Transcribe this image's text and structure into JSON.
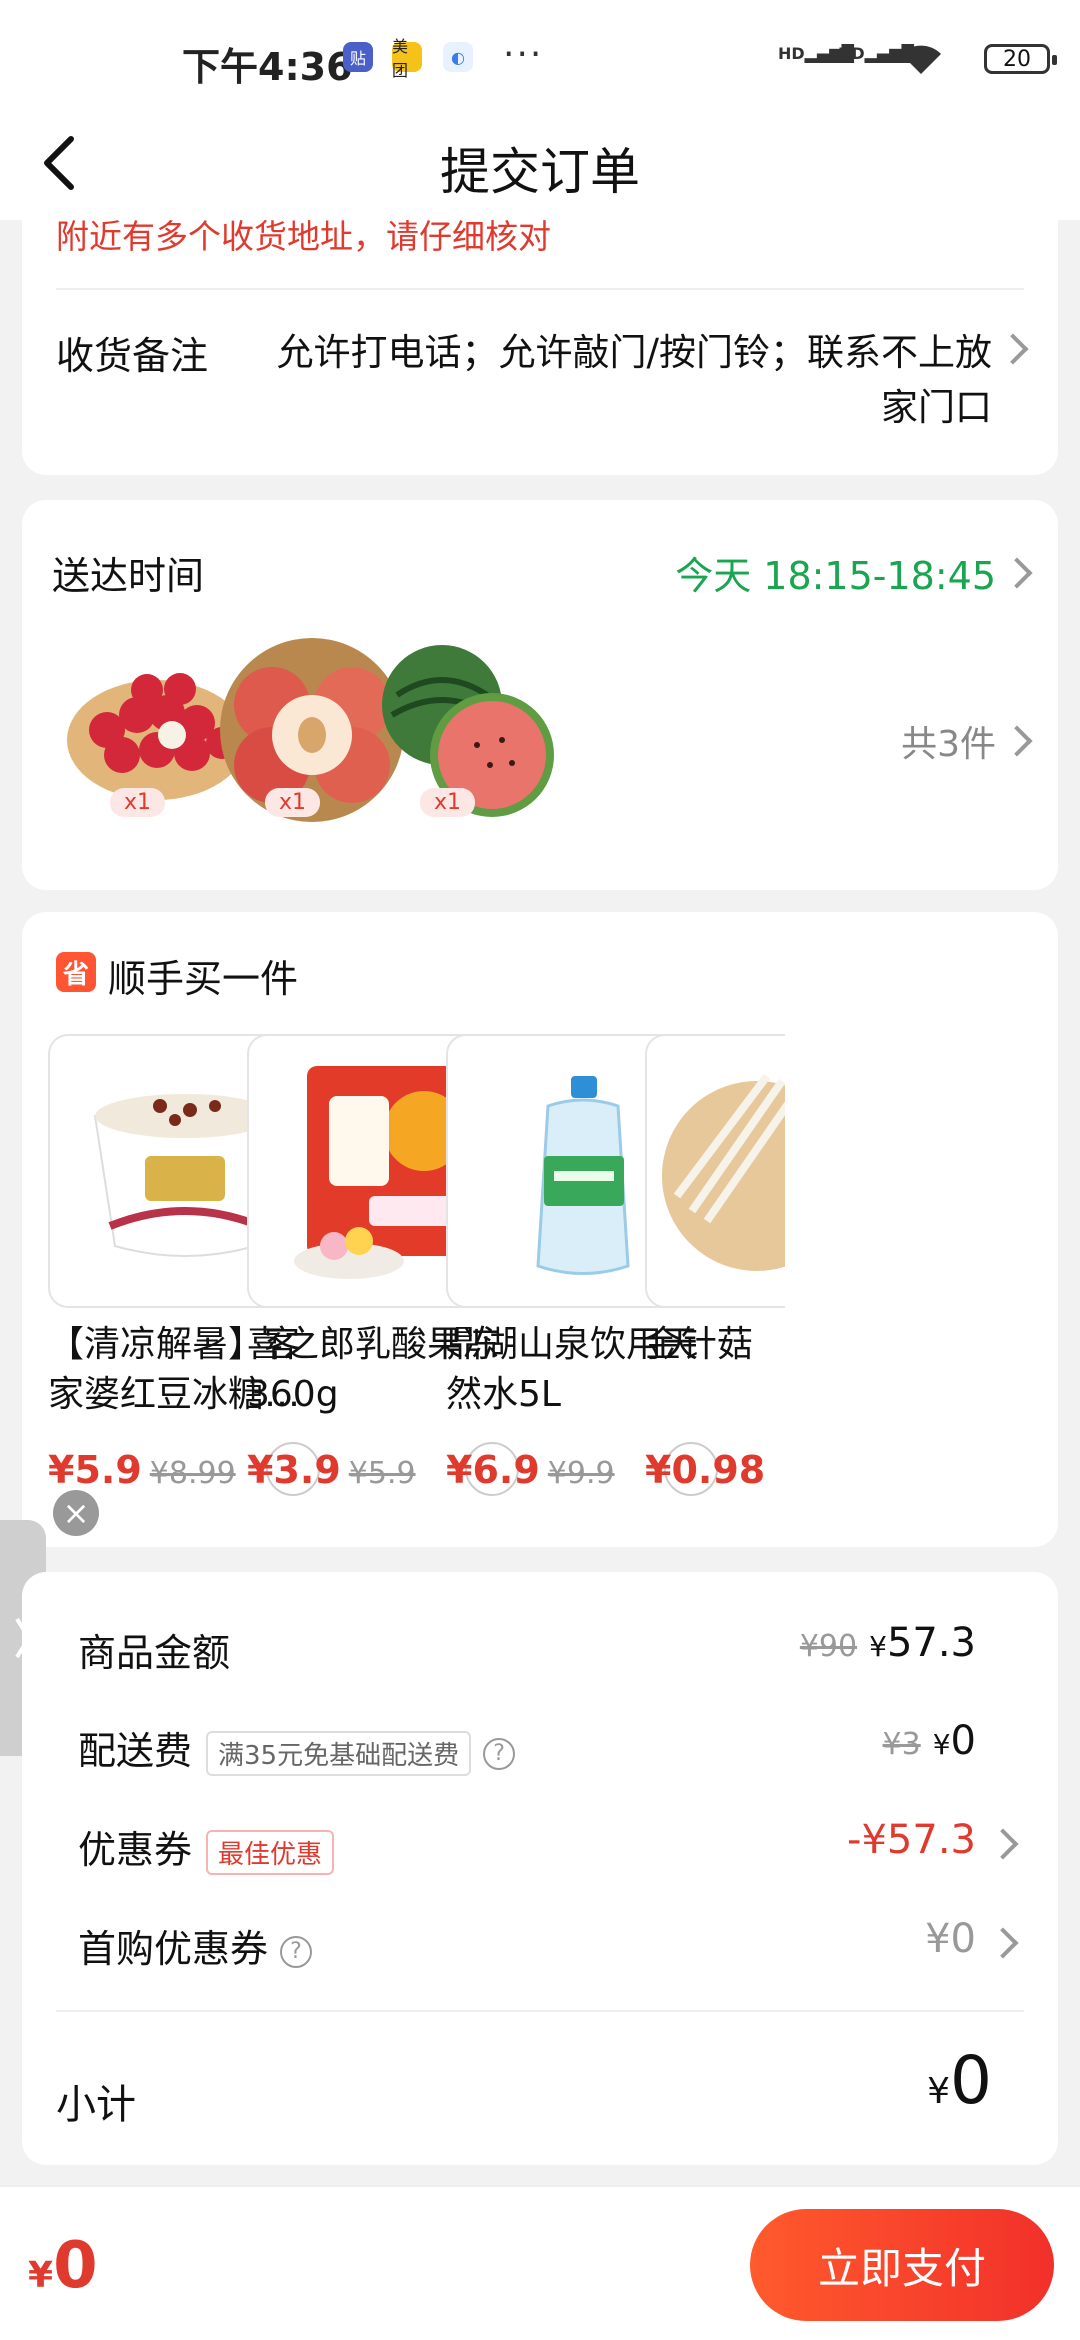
{
  "status_bar": {
    "time": "下午4:36",
    "battery": "20",
    "icons": [
      "tie-icon",
      "meituan-icon",
      "app-icon"
    ],
    "dots": "···",
    "signal": [
      "HD",
      "HD"
    ]
  },
  "nav": {
    "title": "提交订单"
  },
  "address": {
    "warning": "附近有多个收货地址，请仔细核对",
    "note_label": "收货备注",
    "note_value": "允许打电话；允许敲门/按门铃；联系不上放家门口"
  },
  "delivery": {
    "label": "送达时间",
    "time": "今天 18:15-18:45",
    "products": [
      {
        "name": "荔枝",
        "qty": "x1"
      },
      {
        "name": "桃子",
        "qty": "x1"
      },
      {
        "name": "西瓜",
        "qty": "x1"
      }
    ],
    "count": "共3件"
  },
  "addon": {
    "badge": "省",
    "title": "顺手买一件",
    "items": [
      {
        "name": "【清凉解暑】客家婆红豆冰糖…",
        "price": "¥5.9",
        "orig": "¥8.99"
      },
      {
        "name": "喜之郎乳酸果冻360g",
        "price": "¥3.9",
        "orig": "¥5.9"
      },
      {
        "name": "鼎湖山泉饮用天然水5L",
        "price": "¥6.9",
        "orig": "¥9.9"
      },
      {
        "name": "金针菇",
        "price": "¥0.98",
        "orig": ""
      }
    ]
  },
  "summary": {
    "goods_label": "商品金额",
    "goods_orig": "¥90",
    "goods_value": "57.3",
    "delivery_label": "配送费",
    "delivery_tag": "满35元免基础配送费",
    "delivery_orig": "¥3",
    "delivery_value": "0",
    "coupon_label": "优惠券",
    "coupon_tag": "最佳优惠",
    "coupon_value": "-¥57.3",
    "first_coupon_label": "首购优惠券",
    "first_coupon_value": "¥0",
    "subtotal_label": "小计",
    "subtotal_value": "0",
    "currency": "¥"
  },
  "bottom": {
    "total": "0",
    "currency": "¥",
    "pay_label": "立即支付"
  },
  "colors": {
    "accent_red": "#e03a2e",
    "green": "#1aa550",
    "pay_gradient_start": "#ff5a2d",
    "pay_gradient_end": "#f2302a"
  }
}
